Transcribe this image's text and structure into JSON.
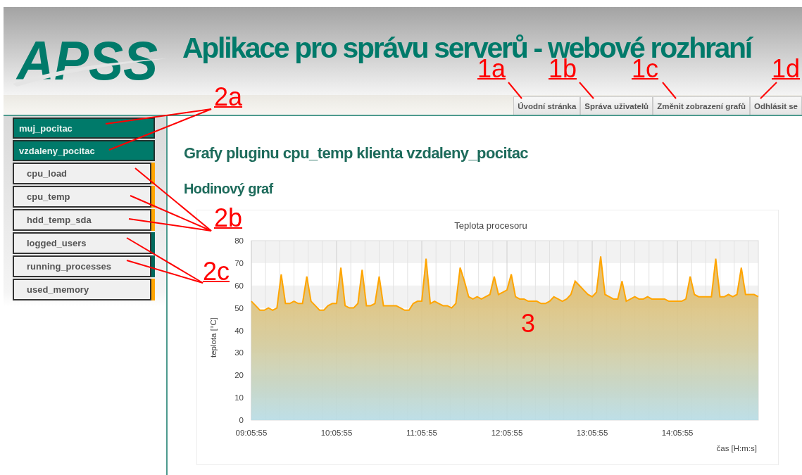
{
  "header": {
    "logo": "APSS",
    "title": "Aplikace pro správu serverů - webové rozhraní"
  },
  "nav": [
    {
      "label": "Úvodní stránka"
    },
    {
      "label": "Správa uživatelů"
    },
    {
      "label": "Změnit zobrazení grafů"
    },
    {
      "label": "Odhlásit se"
    }
  ],
  "sidebar": {
    "items": [
      {
        "label": "muj_pocitac",
        "kind": "host"
      },
      {
        "label": "vzdaleny_pocitac",
        "kind": "host",
        "children": [
          {
            "label": "cpu_load",
            "kind": "plugin",
            "color": "#ffa500"
          },
          {
            "label": "cpu_temp",
            "kind": "plugin",
            "color": "#ffa500"
          },
          {
            "label": "hdd_temp_sda",
            "kind": "plugin",
            "color": "#ffa500"
          },
          {
            "label": "logged_users",
            "kind": "plugin",
            "color": "#00695c"
          },
          {
            "label": "running_processes",
            "kind": "plugin",
            "color": "#00695c"
          },
          {
            "label": "used_memory",
            "kind": "plugin",
            "color": "#ffa500"
          }
        ]
      }
    ]
  },
  "content": {
    "heading": "Grafy pluginu cpu_temp klienta vzdaleny_pocitac",
    "subheading": "Hodinový graf",
    "chart_data": {
      "type": "area",
      "title": "Teplota procesoru",
      "xlabel": "čas [H:m:s]",
      "ylabel": "teplota [°C]",
      "categories": [
        "09:05:55",
        null,
        null,
        null,
        null,
        null,
        null,
        null,
        null,
        null,
        null,
        null,
        null,
        null,
        null,
        null,
        null,
        null,
        null,
        null,
        "10:05:55",
        null,
        null,
        null,
        null,
        null,
        null,
        null,
        null,
        null,
        null,
        null,
        null,
        null,
        null,
        null,
        null,
        null,
        null,
        null,
        "11:05:55",
        null,
        null,
        null,
        null,
        null,
        null,
        null,
        null,
        null,
        null,
        null,
        null,
        null,
        null,
        null,
        null,
        null,
        null,
        null,
        "12:05:55",
        null,
        null,
        null,
        null,
        null,
        null,
        null,
        null,
        null,
        null,
        null,
        null,
        null,
        null,
        null,
        null,
        null,
        null,
        null,
        "13:05:55",
        null,
        null,
        null,
        null,
        null,
        null,
        null,
        null,
        null,
        null,
        null,
        null,
        null,
        null,
        null,
        null,
        null,
        null,
        null,
        "14:05:55",
        null,
        null,
        null,
        null,
        null,
        null,
        null,
        null,
        null,
        null,
        null,
        null,
        null,
        null,
        null,
        null,
        null,
        null,
        null
      ],
      "series": [
        {
          "color": "#ffa500",
          "values": [
            53,
            51,
            49,
            49,
            50,
            49,
            50,
            65,
            52,
            52,
            53,
            52,
            52,
            64,
            53,
            51,
            49,
            49,
            51,
            52,
            52,
            68,
            51,
            50,
            50,
            52,
            67,
            51,
            51,
            52,
            64,
            51,
            51,
            51,
            51,
            50,
            49,
            49,
            52,
            53,
            53,
            72,
            52,
            53,
            52,
            51,
            51,
            50,
            52,
            68,
            62,
            55,
            54,
            55,
            54,
            55,
            56,
            64,
            56,
            57,
            58,
            65,
            55,
            54,
            54,
            53,
            53,
            53,
            52,
            52,
            53,
            55,
            54,
            53,
            54,
            56,
            62,
            60,
            58,
            56,
            55,
            57,
            73,
            56,
            55,
            54,
            54,
            62,
            53,
            54,
            55,
            54,
            54,
            55,
            54,
            54,
            54,
            54,
            53,
            53,
            53,
            53,
            54,
            64,
            56,
            55,
            55,
            55,
            55,
            72,
            55,
            55,
            56,
            55,
            56,
            68,
            56,
            56,
            56,
            55
          ]
        }
      ],
      "grid": true,
      "ylim": [
        0,
        80
      ],
      "yticks": [
        0,
        10,
        20,
        30,
        40,
        50,
        60,
        70,
        80
      ]
    }
  },
  "annotations": [
    {
      "label": "1a"
    },
    {
      "label": "1b"
    },
    {
      "label": "1c"
    },
    {
      "label": "1d"
    },
    {
      "label": "2a"
    },
    {
      "label": "2b"
    },
    {
      "label": "2c"
    },
    {
      "label": "3"
    }
  ]
}
